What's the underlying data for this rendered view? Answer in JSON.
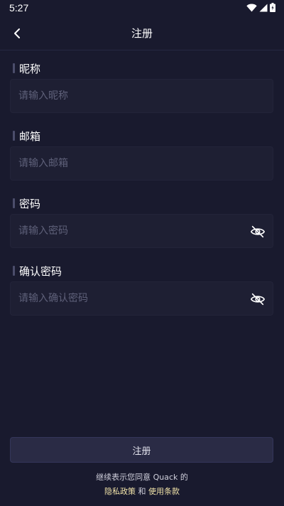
{
  "status_bar": {
    "time": "5:27"
  },
  "nav": {
    "title": "注册"
  },
  "form": {
    "nickname": {
      "label": "昵称",
      "placeholder": "请输入昵称",
      "value": ""
    },
    "email": {
      "label": "邮箱",
      "placeholder": "请输入邮箱",
      "value": ""
    },
    "password": {
      "label": "密码",
      "placeholder": "请输入密码",
      "value": ""
    },
    "confirm_password": {
      "label": "确认密码",
      "placeholder": "请输入确认密码",
      "value": ""
    }
  },
  "register_button": {
    "label": "注册"
  },
  "agreement": {
    "text": "继续表示您同意 Quack 的",
    "privacy_link": "隐私政策",
    "and": "和",
    "terms_link": "使用条款"
  },
  "icons": {
    "back": "chevron-left-icon",
    "eye_hidden": "eye-off-icon",
    "wifi": "wifi-icon",
    "signal": "signal-icon",
    "battery": "battery-icon"
  },
  "colors": {
    "background": "#191a2e",
    "input_background": "#1e1f33",
    "button_background": "#2a2b45",
    "link": "#f0e2a8"
  }
}
